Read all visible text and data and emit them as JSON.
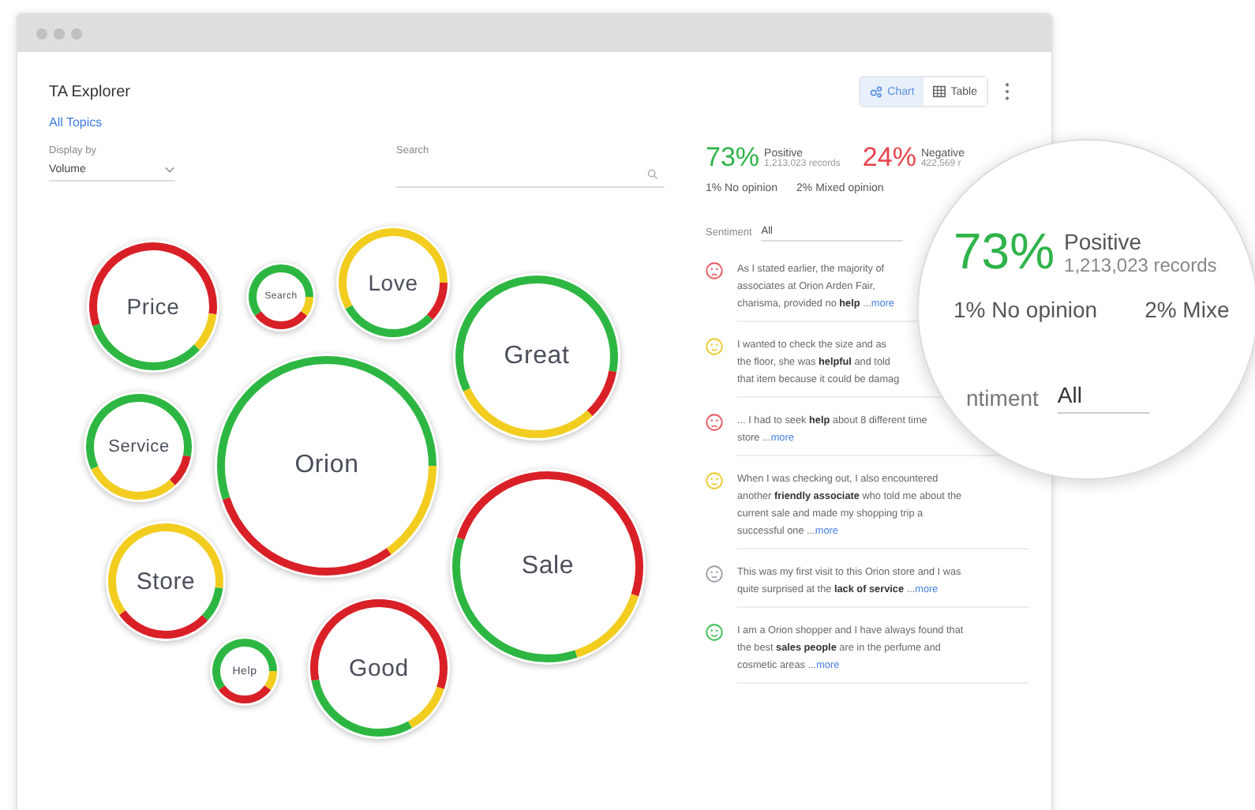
{
  "window": {
    "title": "TA Explorer"
  },
  "breadcrumb": "All Topics",
  "view_toggle": [
    {
      "kind": "chart",
      "label": "Chart",
      "selected": true
    },
    {
      "kind": "table",
      "label": "Table",
      "selected": false
    }
  ],
  "display_by": {
    "label": "Display by",
    "value": "Volume"
  },
  "search": {
    "label": "Search"
  },
  "bubbles": [
    {
      "label": "Price"
    },
    {
      "label": "Search"
    },
    {
      "label": "Love"
    },
    {
      "label": "Great"
    },
    {
      "label": "Service"
    },
    {
      "label": "Orion"
    },
    {
      "label": "Store"
    },
    {
      "label": "Sale"
    },
    {
      "label": "Help"
    },
    {
      "label": "Good"
    }
  ],
  "stats": [
    {
      "kind": "positive",
      "percent": "73%",
      "label": "Positive",
      "records": "1,213,023 records"
    },
    {
      "kind": "negative",
      "percent": "24%",
      "label": "Negative",
      "records": "422,569 r"
    }
  ],
  "minor_stats": [
    "1% No opinion",
    "2% Mixed opinion"
  ],
  "sentiment_filter": {
    "label": "Sentiment",
    "value": "All"
  },
  "comments": [
    {
      "kind": "negative",
      "lines": [
        "As I stated earlier, the majority of",
        "associates at Orion Arden Fair,",
        "charisma, provided no **help** ..."
      ],
      "more": "more"
    },
    {
      "kind": "mixed",
      "lines": [
        "I wanted to check the size and as",
        "the floor, she was **helpful** and told",
        "that item because it could be damag"
      ]
    },
    {
      "kind": "negative",
      "lines": [
        "... I had to seek **help** about 8 different time",
        "store ..."
      ],
      "more": "more"
    },
    {
      "kind": "mixed",
      "lines": [
        "When I was checking out, I also encountered",
        "another **friendly associate** who told me about the",
        "current sale and made my shopping trip a",
        "successful one ..."
      ],
      "more": "more"
    },
    {
      "kind": "neutral",
      "lines": [
        "This was my first visit to this Orion store and I was",
        "quite surprised at the **lack of service** ..."
      ],
      "more": "more"
    },
    {
      "kind": "positive",
      "lines": [
        "I am a Orion shopper and I have always found that",
        "the best **sales people** are in the perfume and",
        "cosmetic areas ..."
      ],
      "more": "more"
    }
  ],
  "magnifier": {
    "kind": "positive",
    "percent": "73%",
    "label": "Positive",
    "records": "1,213,023 records",
    "minor_stats": [
      "1% No opinion",
      "2% Mixe"
    ],
    "filter_label": "ntiment",
    "filter_value": "All"
  }
}
